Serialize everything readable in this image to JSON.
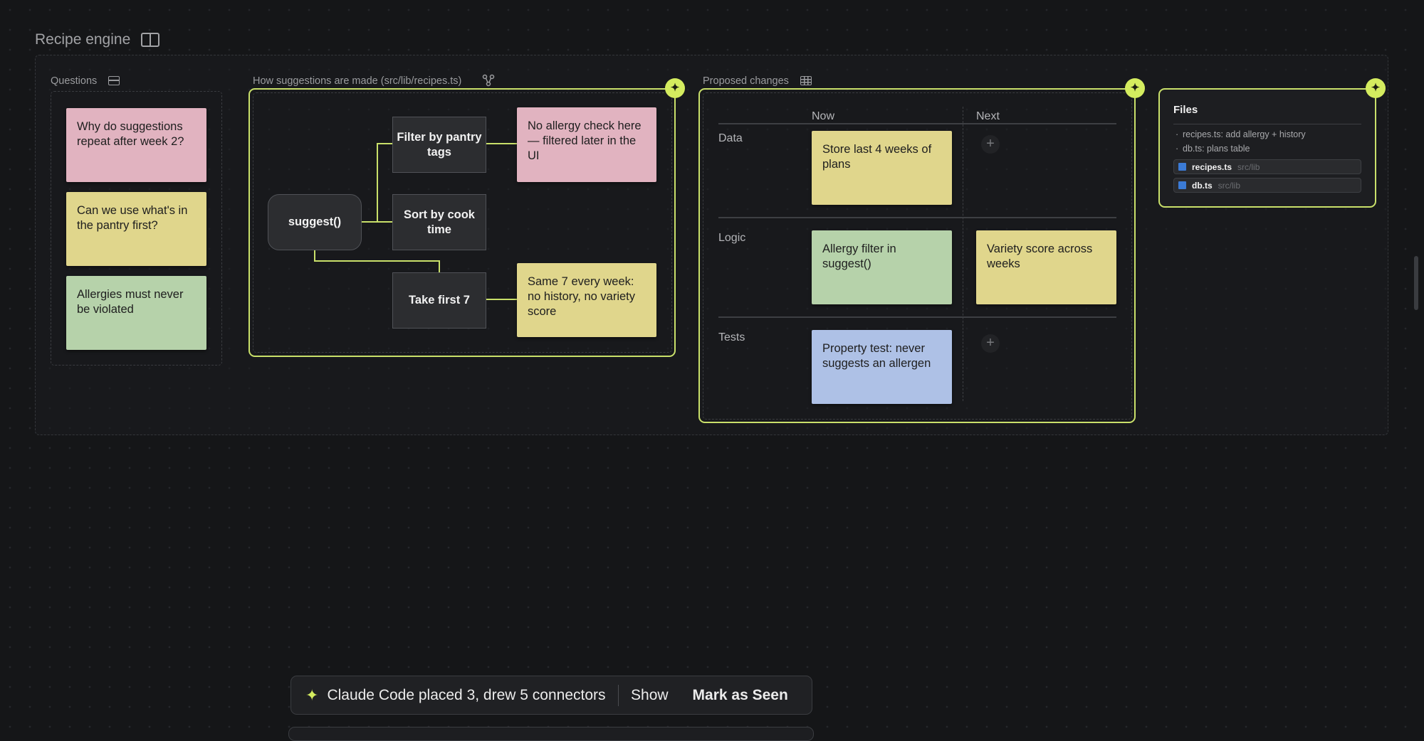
{
  "board": {
    "title": "Recipe engine",
    "layout_icon": "split-panel-icon"
  },
  "questions": {
    "label": "Questions",
    "icon": "list-panel-icon",
    "notes": [
      {
        "text": "Why do suggestions repeat after week 2?",
        "color": "#e1b3c0"
      },
      {
        "text": "Can we use what's in the pantry first?",
        "color": "#e0d68c"
      },
      {
        "text": "Allergies must never be violated",
        "color": "#b6d2aa"
      }
    ]
  },
  "flow": {
    "label": "How suggestions are made (src/lib/recipes.ts)",
    "icon": "graph-nodes-icon",
    "nodes": {
      "suggest": "suggest()",
      "filter": "Filter by pantry tags",
      "sort": "Sort by cook time",
      "take": "Take first 7"
    },
    "notes": {
      "filter_note": "No allergy check here — filtered later in the UI",
      "take_note": "Same 7 every week: no history, no variety score"
    }
  },
  "changes": {
    "label": "Proposed changes",
    "icon": "table-grid-icon",
    "columns": [
      "Now",
      "Next"
    ],
    "rows": [
      {
        "name": "Data",
        "now": "Store last 4 weeks of plans",
        "now_color": "#e0d68c",
        "next": null
      },
      {
        "name": "Logic",
        "now": "Allergy filter in suggest()",
        "now_color": "#b6d2aa",
        "next": "Variety score across weeks",
        "next_color": "#e0d68c"
      },
      {
        "name": "Tests",
        "now": "Property test: never suggests an allergen",
        "now_color": "#aec1e6",
        "next": null
      }
    ],
    "add_label": "+"
  },
  "files": {
    "title": "Files",
    "bullets": [
      "recipes.ts: add allergy + history",
      "db.ts: plans table"
    ],
    "items": [
      {
        "name": "recipes.ts",
        "path": "src/lib"
      },
      {
        "name": "db.ts",
        "path": "src/lib"
      }
    ]
  },
  "toast": {
    "message": "Claude Code placed 3, drew 5 connectors",
    "show": "Show",
    "mark_seen": "Mark as Seen"
  },
  "colors": {
    "accent": "#c9e06a",
    "sparkle": "#d4ec5f",
    "background": "#151618"
  }
}
